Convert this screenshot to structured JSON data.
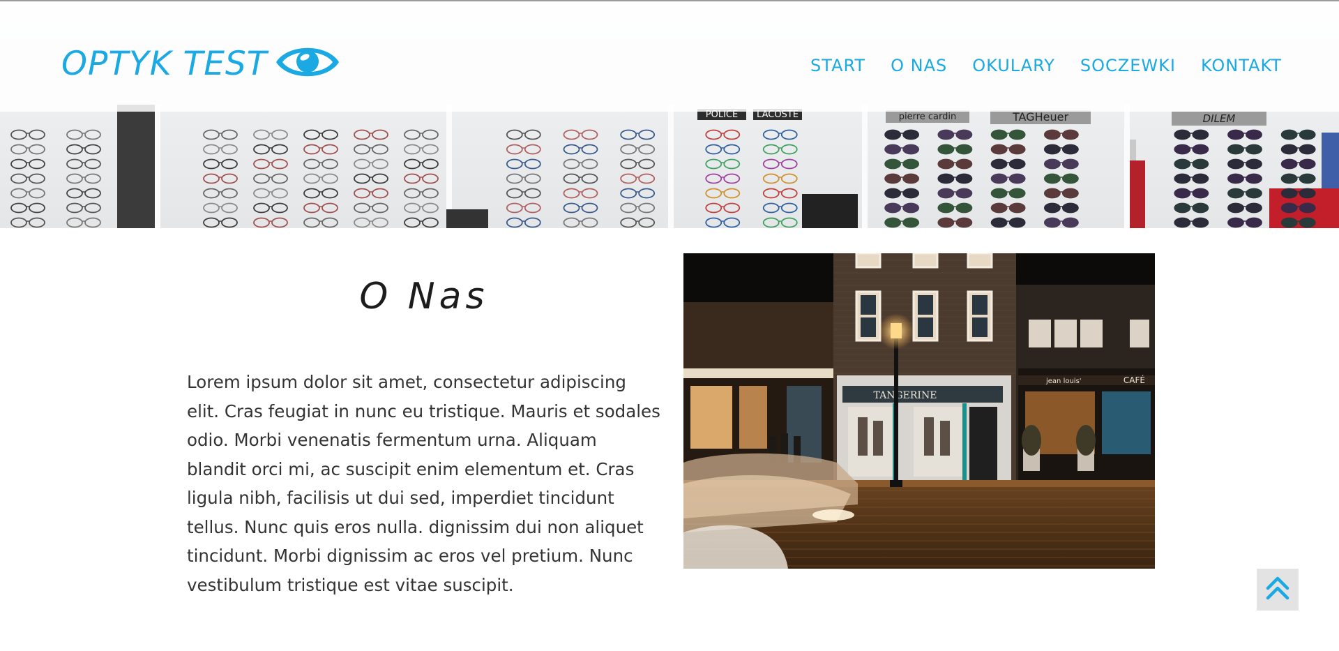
{
  "brand": {
    "name": "OPTYK TEST",
    "accent_color": "#1aa9e3",
    "logo_icon": "eye-icon"
  },
  "nav": {
    "items": [
      {
        "label": "START"
      },
      {
        "label": "O NAS"
      },
      {
        "label": "OKULARY"
      },
      {
        "label": "SOCZEWKI"
      },
      {
        "label": "KONTAKT"
      }
    ]
  },
  "hero": {
    "image": "eyeglasses-display-photo",
    "shelf_signs": [
      "POLICE",
      "LACOSTE",
      "pierre cardin",
      "TAGHeuer",
      "DILEM"
    ]
  },
  "about": {
    "title": "O Nas",
    "body": "Lorem ipsum dolor sit amet, consectetur adipiscing elit. Cras feugiat in nunc eu tristique. Mauris et sodales odio. Morbi venenatis fermentum urna. Aliquam blandit orci mi, ac suscipit enim elementum et. Cras ligula nibh, facilisis ut dui sed, imperdiet tincidunt tellus. Nunc quis eros nulla. dignissim dui non aliquet tincidunt. Morbi dignissim ac eros vel pretium. Nunc vestibulum tristique est vitae suscipit.",
    "photo": "night-street-storefront-photo",
    "photo_signs": [
      "TANGERINE",
      "jean louis'",
      "CAFÉ"
    ]
  },
  "scroll_top": {
    "icon": "double-chevron-up-icon"
  }
}
